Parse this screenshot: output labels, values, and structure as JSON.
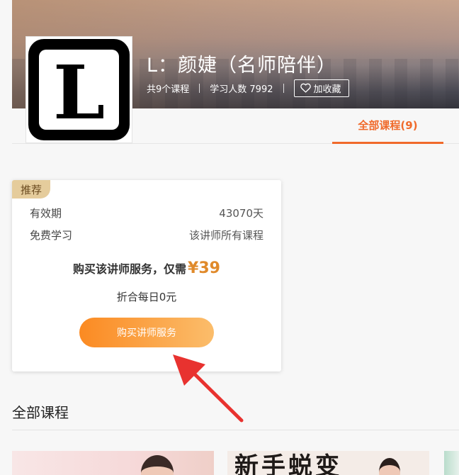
{
  "header": {
    "title": "L：颜婕（名师陪伴）",
    "course_count": "共9个课程",
    "learners": "学习人数 7992",
    "favorite_label": "加收藏",
    "logo_letter": "L"
  },
  "tabs": [
    {
      "label": "全部课程(9)",
      "active": true
    }
  ],
  "service_card": {
    "badge": "推荐",
    "rows": [
      {
        "label": "有效期",
        "value": "43070天"
      },
      {
        "label": "免费学习",
        "value": "该讲师所有课程"
      }
    ],
    "price_prefix": "购买该讲师服务，仅需",
    "price": "¥39",
    "daily": "折合每日0元",
    "buy_button": "购买讲师服务"
  },
  "courses_section": {
    "title": "全部课程",
    "thumb2_text": "新手蜕变"
  },
  "colors": {
    "accent": "#f06a2b",
    "price": "#e08a2b",
    "badge_bg": "#e5cc9c",
    "arrow": "#e8322f"
  }
}
